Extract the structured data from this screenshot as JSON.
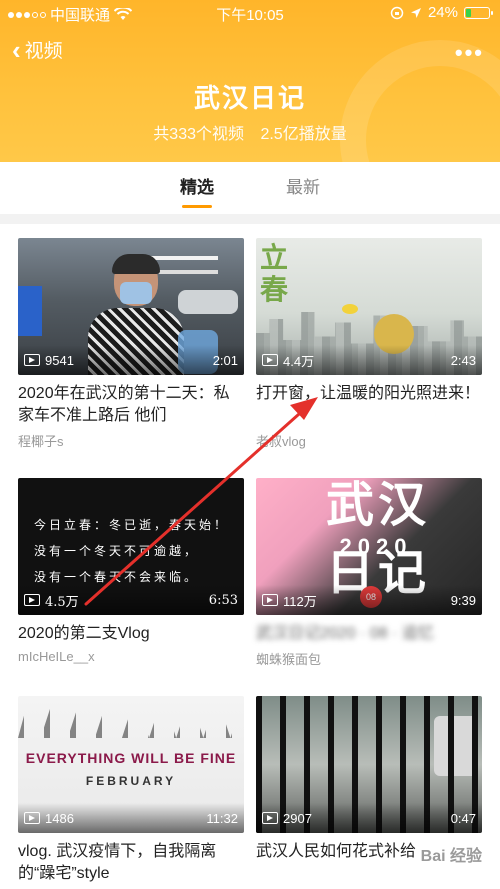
{
  "status": {
    "carrier": "中国联通",
    "time": "下午10:05",
    "battery": "24%"
  },
  "nav": {
    "back_label": "视频"
  },
  "header": {
    "title": "武汉日记",
    "count": "共333个视频",
    "plays": "2.5亿播放量"
  },
  "tabs": [
    {
      "label": "精选",
      "active": true
    },
    {
      "label": "最新",
      "active": false
    }
  ],
  "videos": [
    {
      "views": "9541",
      "duration": "2:01",
      "title": "2020年在武汉的第十二天：私家车不准上路后 他们",
      "author": "程椰子s"
    },
    {
      "views": "4.4万",
      "duration": "2:43",
      "title": "打开窗，让温暖的阳光照进来！",
      "author": "老叔vlog",
      "thumb_text": "立春"
    },
    {
      "views": "4.5万",
      "duration": "6:53",
      "title": "2020的第二支Vlog",
      "author": "mIcHeILe__x",
      "thumb_lines": [
        "今日立春：冬已逝，春天始！",
        "没有一个冬天不可逾越，",
        "没有一个春天不会来临。"
      ]
    },
    {
      "views": "112万",
      "duration": "9:39",
      "title": "武汉日记2020 · 08 · 追忆",
      "author": "蜘蛛猴面包",
      "thumb_top": "武汉",
      "thumb_year": "2020",
      "thumb_bottom": "日记",
      "thumb_badge": "08"
    },
    {
      "views": "1486",
      "duration": "11:32",
      "title": "vlog. 武汉疫情下，自我隔离的“躁宅”style",
      "author": "",
      "thumb_line1": "EVERYTHING WILL BE FINE",
      "thumb_line2": "FEBRUARY"
    },
    {
      "views": "2907",
      "duration": "0:47",
      "title": "武汉人民如何花式补给",
      "author": ""
    }
  ],
  "watermark": "Bai 经验",
  "colors": {
    "header": "#ffbb33",
    "tab_indicator": "#ff9a00",
    "annotation_arrow": "#e4302b"
  }
}
